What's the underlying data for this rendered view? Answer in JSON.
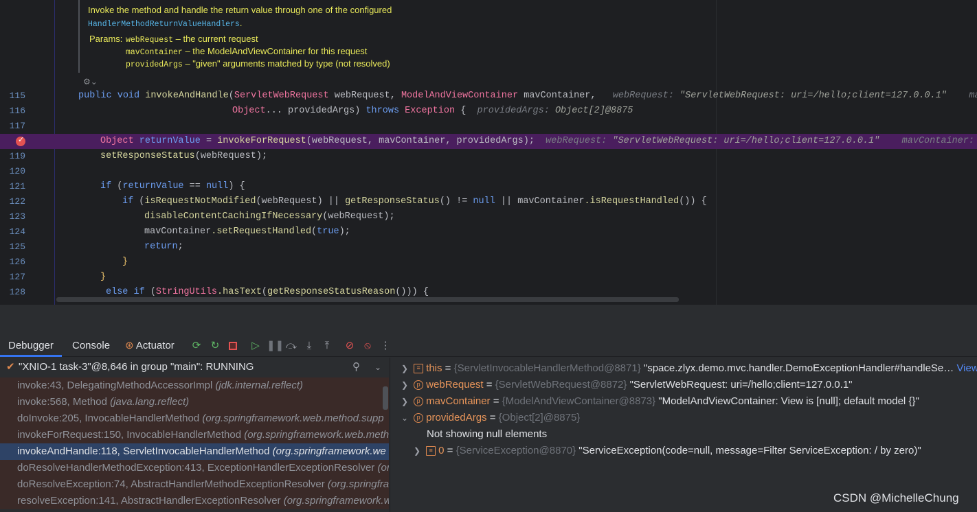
{
  "doc": {
    "line1": "Invoke the method and handle the return value through one of the configured",
    "line2_code": "HandlerMethodReturnValueHandlers",
    "line2_tail": ".",
    "params_label": "Params:",
    "params": [
      {
        "name": "webRequest",
        "desc": " – the current request"
      },
      {
        "name": "mavContainer",
        "desc": " – the ModelAndViewContainer for this request"
      },
      {
        "name": "providedArgs",
        "desc": " – \"given\" arguments matched by type (not resolved)"
      }
    ],
    "render_icon": "reader-mode-icon"
  },
  "lines": [
    {
      "num": "115"
    },
    {
      "num": "116"
    },
    {
      "num": "117"
    },
    {
      "num": "118"
    },
    {
      "num": "119"
    },
    {
      "num": "120"
    },
    {
      "num": "121"
    },
    {
      "num": "122"
    },
    {
      "num": "123"
    },
    {
      "num": "124"
    },
    {
      "num": "125"
    },
    {
      "num": "126"
    },
    {
      "num": "127"
    },
    {
      "num": "128"
    }
  ],
  "code": {
    "l115": {
      "public": "public",
      "void": "void",
      "method": "invokeAndHandle",
      "p1type": "ServletWebRequest",
      "p1": "webRequest",
      "p2type": "ModelAndViewContainer",
      "p2": "mavContainer",
      "hint_name": "webRequest:",
      "hint_val": "\"ServletWebRequest: uri=/hello;client=127.0.0.1\"",
      "hint_tail": "mavC"
    },
    "l116": {
      "type": "Object",
      "dots": "...",
      "p": "providedArgs",
      "throws": "throws",
      "ex": "Exception",
      "brace": "{",
      "hint_name": "providedArgs:",
      "hint_val": "Object[2]@8875"
    },
    "l118": {
      "type": "Object",
      "var": "returnValue",
      "eq": " = ",
      "call": "invokeForRequest",
      "args": "(webRequest, mavContainer, providedArgs);",
      "hint1_name": "webRequest:",
      "hint1_val": "\"ServletWebRequest: uri=/hello;client=127.0.0.1\"",
      "hint2_name": "mavContainer:",
      "hint2_val": "\""
    },
    "l119": {
      "call": "setResponseStatus",
      "args": "(webRequest);"
    },
    "l121": {
      "if": "if",
      "var": "returnValue",
      "op": " == ",
      "null": "null",
      "tail": ") {"
    },
    "l122": {
      "if": "if",
      "c1": "isRequestNotModified",
      "a1": "webRequest",
      "or": " || ",
      "c2": "getResponseStatus",
      "ne": "() != ",
      "null": "null",
      "or2": " || ",
      "obj": "mavContainer",
      "c3": ".isRequestHandled",
      "tail": "()) {"
    },
    "l123": {
      "call": "disableContentCachingIfNecessary",
      "args": "(webRequest);"
    },
    "l124": {
      "obj": "mavContainer",
      "call": ".setRequestHandled",
      "open": "(",
      "true": "true",
      "close": ");"
    },
    "l125": {
      "ret": "return",
      "semi": ";"
    },
    "l126": {
      "brace": "}"
    },
    "l127": {
      "brace": "}"
    },
    "l128": {
      "else": "else",
      "if": "if",
      "cls": "StringUtils",
      "call": ".hasText",
      "inner": "getResponseStatusReason",
      "tail": "())) {"
    }
  },
  "tabs": {
    "debugger": "Debugger",
    "console": "Console",
    "actuator": "Actuator"
  },
  "toolbar_icons": [
    "rerun-icon",
    "restart-icon",
    "stop-icon",
    "resume-icon",
    "pause-icon",
    "step-over-icon",
    "step-into-icon",
    "step-out-icon",
    "view-breakpoints-icon",
    "mute-breakpoints-icon",
    "more-icon"
  ],
  "thread": {
    "label": "\"XNIO-1 task-3\"@8,646 in group \"main\": RUNNING"
  },
  "frames": [
    {
      "method": "invoke:43, DelegatingMethodAccessorImpl ",
      "pkg": "(jdk.internal.reflect)"
    },
    {
      "method": "invoke:568, Method ",
      "pkg": "(java.lang.reflect)"
    },
    {
      "method": "doInvoke:205, InvocableHandlerMethod ",
      "pkg": "(org.springframework.web.method.supp"
    },
    {
      "method": "invokeForRequest:150, InvocableHandlerMethod ",
      "pkg": "(org.springframework.web.meth"
    },
    {
      "method": "invokeAndHandle:118, ServletInvocableHandlerMethod ",
      "pkg": "(org.springframework.we"
    },
    {
      "method": "doResolveHandlerMethodException:413, ExceptionHandlerExceptionResolver ",
      "pkg": "(or"
    },
    {
      "method": "doResolveException:74, AbstractHandlerMethodExceptionResolver ",
      "pkg": "(org.springfra"
    },
    {
      "method": "resolveException:141, AbstractHandlerExceptionResolver ",
      "pkg": "(org.springframework.we"
    }
  ],
  "variables": {
    "this": {
      "name": "this",
      "eq": " = ",
      "type": "{ServletInvocableHandlerMethod@8871}",
      "value": " \"space.zlyx.demo.mvc.handler.DemoExceptionHandler#handleSe…",
      "link": "View"
    },
    "webRequest": {
      "name": "webRequest",
      "eq": " = ",
      "type": "{ServletWebRequest@8872}",
      "value": " \"ServletWebRequest: uri=/hello;client=127.0.0.1\""
    },
    "mavContainer": {
      "name": "mavContainer",
      "eq": " = ",
      "type": "{ModelAndViewContainer@8873}",
      "value": " \"ModelAndViewContainer: View is [null]; default model {}\""
    },
    "providedArgs": {
      "name": "providedArgs",
      "eq": " = ",
      "type": "{Object[2]@8875}"
    },
    "note": "Not showing null elements",
    "elem0": {
      "name": "0",
      "eq": " = ",
      "type": "{ServiceException@8870}",
      "value": " \"ServiceException(code=null, message=Filter ServiceException: / by zero)\""
    }
  },
  "watermark": "CSDN @MichelleChung",
  "colors": {
    "accent": "#3574f0",
    "breakpoint": "#e35252",
    "highlight_line": "#4a1e5e",
    "selected_frame": "#2e4366"
  }
}
